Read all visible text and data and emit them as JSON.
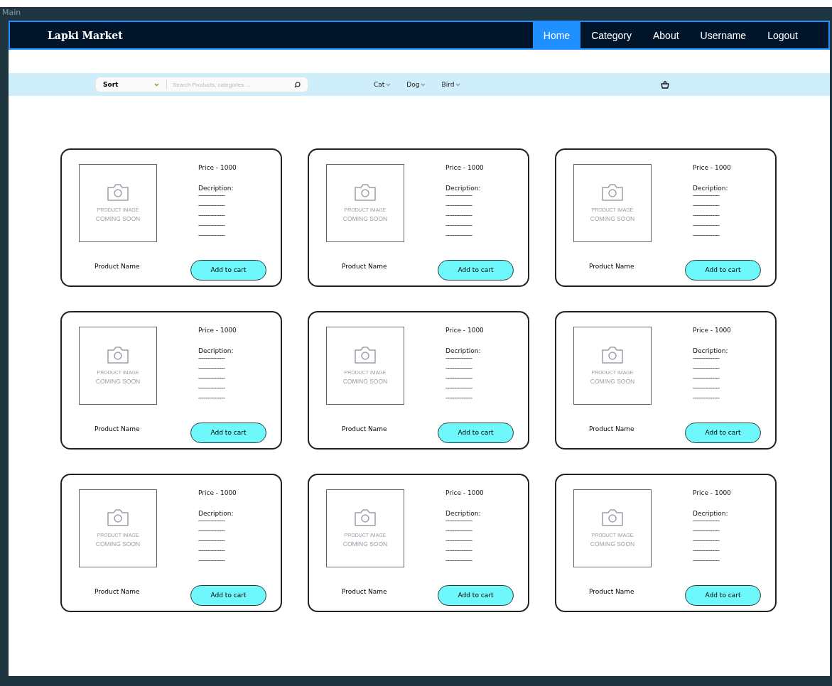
{
  "frame": {
    "title": "Main"
  },
  "navbar": {
    "brand": "Lapki Market",
    "items": [
      {
        "label": "Home",
        "selected": true
      },
      {
        "label": "Category",
        "selected": false
      },
      {
        "label": "About",
        "selected": false
      },
      {
        "label": "Username",
        "selected": false
      },
      {
        "label": "Logout",
        "selected": false
      }
    ]
  },
  "filter_bar": {
    "sort": "Sort",
    "search": {
      "placeholder": "Search Products, categories ..."
    },
    "categories": [
      "Cat",
      "Dog",
      "Bird"
    ]
  },
  "products": [
    {
      "image": {
        "line_1": "PRODUCT IMAGE",
        "line_2": "COMING SOON"
      },
      "price": "Price - 1000",
      "description_label": "Decription:",
      "description_lines": [
        "---------------",
        "---------------",
        "---------------",
        "---------------",
        "---------------"
      ],
      "name": "Product Name",
      "button": "Add to cart"
    },
    {
      "image": {
        "line_1": "PRODUCT IMAGE",
        "line_2": "COMING SOON"
      },
      "price": "Price - 1000",
      "description_label": "Decription:",
      "description_lines": [
        "---------------",
        "---------------",
        "---------------",
        "---------------",
        "---------------"
      ],
      "name": "Product Name",
      "button": "Add to cart"
    },
    {
      "image": {
        "line_1": "PRODUCT IMAGE",
        "line_2": "COMING SOON"
      },
      "price": "Price - 1000",
      "description_label": "Decription:",
      "description_lines": [
        "---------------",
        "---------------",
        "---------------",
        "---------------",
        "---------------"
      ],
      "name": "Product Name",
      "button": "Add to cart"
    },
    {
      "image": {
        "line_1": "PRODUCT IMAGE",
        "line_2": "COMING SOON"
      },
      "price": "Price - 1000",
      "description_label": "Decription:",
      "description_lines": [
        "---------------",
        "---------------",
        "---------------",
        "---------------",
        "---------------"
      ],
      "name": "Product Name",
      "button": "Add to cart"
    },
    {
      "image": {
        "line_1": "PRODUCT IMAGE",
        "line_2": "COMING SOON"
      },
      "price": "Price - 1000",
      "description_label": "Decription:",
      "description_lines": [
        "---------------",
        "---------------",
        "---------------",
        "---------------",
        "---------------"
      ],
      "name": "Product Name",
      "button": "Add to cart"
    },
    {
      "image": {
        "line_1": "PRODUCT IMAGE",
        "line_2": "COMING SOON"
      },
      "price": "Price - 1000",
      "description_label": "Decription:",
      "description_lines": [
        "---------------",
        "---------------",
        "---------------",
        "---------------",
        "---------------"
      ],
      "name": "Product Name",
      "button": "Add to cart"
    },
    {
      "image": {
        "line_1": "PRODUCT IMAGE",
        "line_2": "COMING SOON"
      },
      "price": "Price - 1000",
      "description_label": "Decription:",
      "description_lines": [
        "---------------",
        "---------------",
        "---------------",
        "---------------",
        "---------------"
      ],
      "name": "Product Name",
      "button": "Add to cart"
    },
    {
      "image": {
        "line_1": "PRODUCT IMAGE",
        "line_2": "COMING SOON"
      },
      "price": "Price - 1000",
      "description_label": "Decription:",
      "description_lines": [
        "---------------",
        "---------------",
        "---------------",
        "---------------",
        "---------------"
      ],
      "name": "Product Name",
      "button": "Add to cart"
    },
    {
      "image": {
        "line_1": "PRODUCT IMAGE",
        "line_2": "COMING SOON"
      },
      "price": "Price - 1000",
      "description_label": "Decription:",
      "description_lines": [
        "---------------",
        "---------------",
        "---------------",
        "---------------",
        "---------------"
      ],
      "name": "Product Name",
      "button": "Add to cart"
    }
  ]
}
